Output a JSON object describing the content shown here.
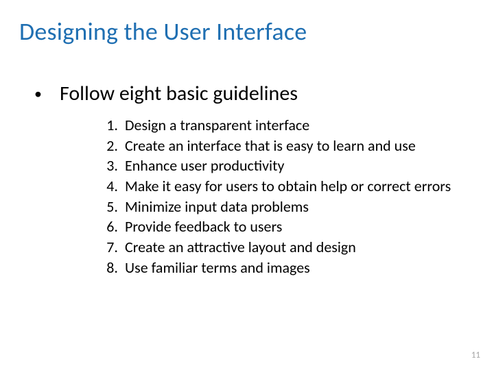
{
  "title": "Designing the User Interface",
  "bullet": "Follow eight basic guidelines",
  "guidelines": {
    "n1": "1.",
    "t1": "Design a transparent interface",
    "n2": "2.",
    "t2": "Create an interface that is easy to learn and use",
    "n3": "3.",
    "t3": "Enhance user productivity",
    "n4": "4.",
    "t4": "Make it easy for users to obtain help or correct errors",
    "n5": "5.",
    "t5": "Minimize input data problems",
    "n6": "6.",
    "t6": "Provide feedback to users",
    "n7": "7.",
    "t7": "Create an attractive layout and design",
    "n8": "8.",
    "t8": "Use familiar terms and images"
  },
  "page_number": "11"
}
